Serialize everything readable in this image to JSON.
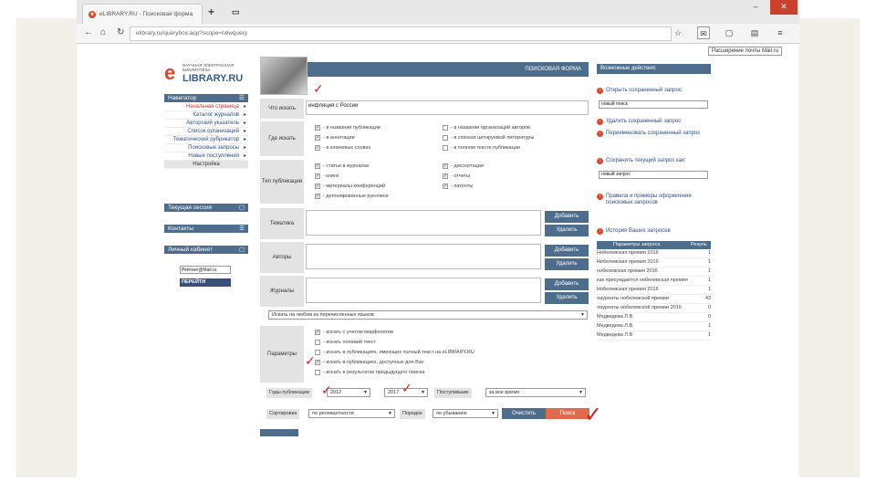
{
  "browser": {
    "tab_title": "eLIBRARY.RU - Поисковая форма",
    "url": "elibrary.ru/querybox.asp?scope=newquery",
    "tooltip": "Расширение почты Mail.ru"
  },
  "logo": {
    "line1": "НАУЧНАЯ ЭЛЕКТРОННАЯ БИБЛИОТЕКА",
    "line2": "LIBRARY.RU"
  },
  "menu": {
    "header": "Навигатор",
    "items": [
      {
        "label": "Начальная страница",
        "style": "red"
      },
      {
        "label": "Каталог журналов",
        "style": "blue"
      },
      {
        "label": "Авторский указатель",
        "style": "blue"
      },
      {
        "label": "Список организаций",
        "style": "blue"
      },
      {
        "label": "Тематический рубрикатор",
        "style": "blue"
      },
      {
        "label": "Поисковые запросы",
        "style": "blue"
      },
      {
        "label": "Новые поступления",
        "style": "blue"
      },
      {
        "label": "Настройка",
        "style": "gray"
      }
    ]
  },
  "blocks": {
    "session": "Текущая сессия",
    "contacts": "Контакты",
    "login": "Личный кабинет"
  },
  "counter": {
    "label": "Рейтинг@Mail.ru",
    "mail": "ПЕРЕЙТИ"
  },
  "form": {
    "title": "ПОИСКОВАЯ ФОРМА",
    "what_label": "Что искать",
    "what_value": "инфляция с России",
    "where_label": "Где искать",
    "where": [
      "- в названии публикации",
      "- в аннотации",
      "- в ключевых словах",
      "- в названии организаций авторов",
      "- в списках цитируемой литературы",
      "- в полном тексте публикации"
    ],
    "type_label": "Тип публикации",
    "types": [
      "- статьи в журналах",
      "- книги",
      "- материалы конференций",
      "- депонированные рукописи",
      "- диссертации",
      "- отчеты",
      "- патенты"
    ],
    "subject_label": "Тематика",
    "authors_label": "Авторы",
    "journals_label": "Журналы",
    "add": "Добавить",
    "del": "Удалить",
    "lang_select": "Искать на любом из перечисленных языков",
    "params_label": "Параметры",
    "params": [
      "- искать с учетом морфологии",
      "- искать похожий текст",
      "- искать в публикациях, имеющих полный текст на eLIBRARY.RU",
      "- искать в публикациях, доступных для Вас",
      "- искать в результатах предыдущего поиска"
    ],
    "years_label": "Годы публикации",
    "year_from": "2012",
    "year_to": "2017",
    "received_label": "Поступившие",
    "received_value": "за все время",
    "sort_label": "Сортировка",
    "sort_value": "по релевантности",
    "order_label": "Порядок",
    "order_value": "по убыванию",
    "clear": "Очистить",
    "search": "Поиск"
  },
  "right": {
    "title": "Возможные действия:",
    "actions": [
      "Открыть сохраненный запрос:",
      "Удалить сохраненный запрос",
      "Переименовать сохраненный запрос",
      "Сохранить текущий запрос как:",
      "Правила и примеры оформления поисковых запросов",
      "История Ваших запросов"
    ],
    "saved_select": "новый поиск",
    "save_as": "новый запрос",
    "table_head": [
      "Параметры запроса",
      "Резуль"
    ],
    "rows": [
      [
        "Нобелевская премия 2016",
        "1"
      ],
      [
        "Нобелевская премия 2016",
        "1"
      ],
      [
        "нобелевская премия 2016",
        "1"
      ],
      [
        "как присуждается нобелевская премия",
        "1"
      ],
      [
        "Нобелевская премия 2016",
        "1"
      ],
      [
        "лауреаты нобелевской премии",
        "43"
      ],
      [
        "лауреаты нобелевской премии 2016",
        "0"
      ],
      [
        "Медведева Л.В",
        "0"
      ],
      [
        "Медведева Л.В",
        "1"
      ],
      [
        "Медведева Л.В",
        "1"
      ]
    ]
  }
}
